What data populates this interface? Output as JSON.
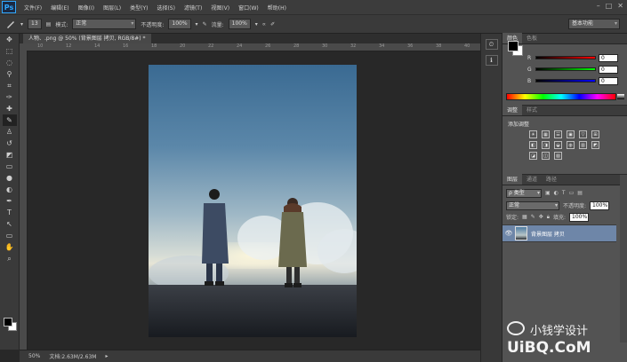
{
  "menu": {
    "logo": "Ps",
    "items": [
      "文件(F)",
      "编辑(E)",
      "图像(I)",
      "图层(L)",
      "类型(Y)",
      "选择(S)",
      "滤镜(T)",
      "视图(V)",
      "窗口(W)",
      "帮助(H)"
    ]
  },
  "options": {
    "brush_size": "13",
    "mode_label": "模式:",
    "mode_value": "正常",
    "opacity_label": "不透明度:",
    "opacity_value": "100%",
    "flow_label": "流量:",
    "flow_value": "100%",
    "workspace": "基本功能"
  },
  "document": {
    "tab_title": "人物、.png @ 50% (背景图层 拷贝, RGB/8#) *",
    "zoom": "50%",
    "doc_size": "文档:2.63M/2.63M",
    "ruler_ticks": [
      "10",
      "12",
      "14",
      "16",
      "18",
      "20",
      "22",
      "24",
      "26",
      "28",
      "30",
      "32",
      "34",
      "36",
      "38",
      "40"
    ]
  },
  "color_panel": {
    "tabs": [
      "颜色",
      "色板"
    ],
    "r_label": "R",
    "r_value": "0",
    "g_label": "G",
    "g_value": "0",
    "b_label": "B",
    "b_value": "0"
  },
  "adjust_panel": {
    "tabs": [
      "调整",
      "样式"
    ],
    "title": "添加调整",
    "icons": [
      "☀",
      "▦",
      "☱",
      "▣",
      "▽",
      "⊞",
      "◧",
      "◨",
      "◒",
      "◍",
      "▥",
      "◩",
      "◪",
      "◫",
      "▧"
    ]
  },
  "layers_panel": {
    "tabs": [
      "图层",
      "通道",
      "路径"
    ],
    "filter_kind": "ρ 类型",
    "blend_mode": "正常",
    "opacity_label": "不透明度:",
    "opacity_value": "100%",
    "lock_label": "锁定:",
    "fill_label": "填充:",
    "fill_value": "100%",
    "layer_name": "背景图层 拷贝"
  },
  "watermark": {
    "line1": "小钱学设计",
    "line2": "UiBQ.CoM"
  }
}
